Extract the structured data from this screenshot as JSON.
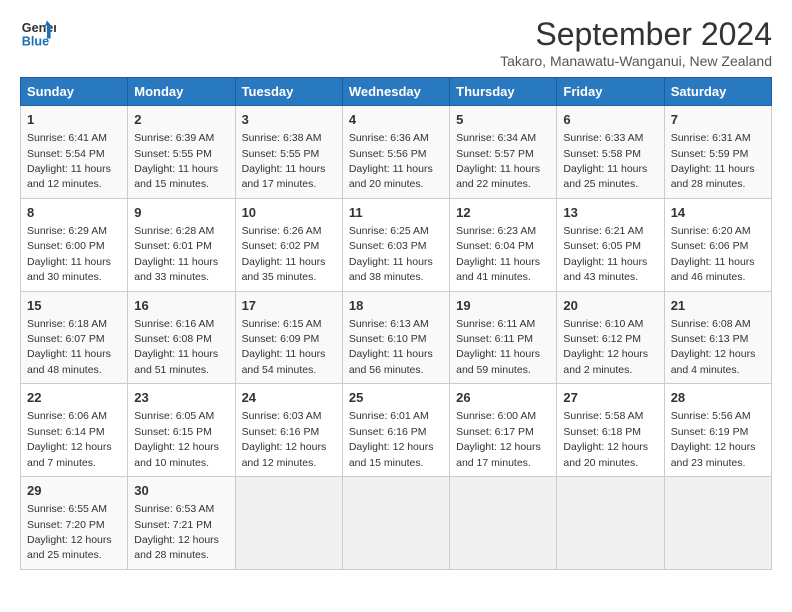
{
  "header": {
    "logo_line1": "General",
    "logo_line2": "Blue",
    "month": "September 2024",
    "location": "Takaro, Manawatu-Wanganui, New Zealand"
  },
  "weekdays": [
    "Sunday",
    "Monday",
    "Tuesday",
    "Wednesday",
    "Thursday",
    "Friday",
    "Saturday"
  ],
  "weeks": [
    [
      {
        "day": "1",
        "info": "Sunrise: 6:41 AM\nSunset: 5:54 PM\nDaylight: 11 hours\nand 12 minutes."
      },
      {
        "day": "2",
        "info": "Sunrise: 6:39 AM\nSunset: 5:55 PM\nDaylight: 11 hours\nand 15 minutes."
      },
      {
        "day": "3",
        "info": "Sunrise: 6:38 AM\nSunset: 5:55 PM\nDaylight: 11 hours\nand 17 minutes."
      },
      {
        "day": "4",
        "info": "Sunrise: 6:36 AM\nSunset: 5:56 PM\nDaylight: 11 hours\nand 20 minutes."
      },
      {
        "day": "5",
        "info": "Sunrise: 6:34 AM\nSunset: 5:57 PM\nDaylight: 11 hours\nand 22 minutes."
      },
      {
        "day": "6",
        "info": "Sunrise: 6:33 AM\nSunset: 5:58 PM\nDaylight: 11 hours\nand 25 minutes."
      },
      {
        "day": "7",
        "info": "Sunrise: 6:31 AM\nSunset: 5:59 PM\nDaylight: 11 hours\nand 28 minutes."
      }
    ],
    [
      {
        "day": "8",
        "info": "Sunrise: 6:29 AM\nSunset: 6:00 PM\nDaylight: 11 hours\nand 30 minutes."
      },
      {
        "day": "9",
        "info": "Sunrise: 6:28 AM\nSunset: 6:01 PM\nDaylight: 11 hours\nand 33 minutes."
      },
      {
        "day": "10",
        "info": "Sunrise: 6:26 AM\nSunset: 6:02 PM\nDaylight: 11 hours\nand 35 minutes."
      },
      {
        "day": "11",
        "info": "Sunrise: 6:25 AM\nSunset: 6:03 PM\nDaylight: 11 hours\nand 38 minutes."
      },
      {
        "day": "12",
        "info": "Sunrise: 6:23 AM\nSunset: 6:04 PM\nDaylight: 11 hours\nand 41 minutes."
      },
      {
        "day": "13",
        "info": "Sunrise: 6:21 AM\nSunset: 6:05 PM\nDaylight: 11 hours\nand 43 minutes."
      },
      {
        "day": "14",
        "info": "Sunrise: 6:20 AM\nSunset: 6:06 PM\nDaylight: 11 hours\nand 46 minutes."
      }
    ],
    [
      {
        "day": "15",
        "info": "Sunrise: 6:18 AM\nSunset: 6:07 PM\nDaylight: 11 hours\nand 48 minutes."
      },
      {
        "day": "16",
        "info": "Sunrise: 6:16 AM\nSunset: 6:08 PM\nDaylight: 11 hours\nand 51 minutes."
      },
      {
        "day": "17",
        "info": "Sunrise: 6:15 AM\nSunset: 6:09 PM\nDaylight: 11 hours\nand 54 minutes."
      },
      {
        "day": "18",
        "info": "Sunrise: 6:13 AM\nSunset: 6:10 PM\nDaylight: 11 hours\nand 56 minutes."
      },
      {
        "day": "19",
        "info": "Sunrise: 6:11 AM\nSunset: 6:11 PM\nDaylight: 11 hours\nand 59 minutes."
      },
      {
        "day": "20",
        "info": "Sunrise: 6:10 AM\nSunset: 6:12 PM\nDaylight: 12 hours\nand 2 minutes."
      },
      {
        "day": "21",
        "info": "Sunrise: 6:08 AM\nSunset: 6:13 PM\nDaylight: 12 hours\nand 4 minutes."
      }
    ],
    [
      {
        "day": "22",
        "info": "Sunrise: 6:06 AM\nSunset: 6:14 PM\nDaylight: 12 hours\nand 7 minutes."
      },
      {
        "day": "23",
        "info": "Sunrise: 6:05 AM\nSunset: 6:15 PM\nDaylight: 12 hours\nand 10 minutes."
      },
      {
        "day": "24",
        "info": "Sunrise: 6:03 AM\nSunset: 6:16 PM\nDaylight: 12 hours\nand 12 minutes."
      },
      {
        "day": "25",
        "info": "Sunrise: 6:01 AM\nSunset: 6:16 PM\nDaylight: 12 hours\nand 15 minutes."
      },
      {
        "day": "26",
        "info": "Sunrise: 6:00 AM\nSunset: 6:17 PM\nDaylight: 12 hours\nand 17 minutes."
      },
      {
        "day": "27",
        "info": "Sunrise: 5:58 AM\nSunset: 6:18 PM\nDaylight: 12 hours\nand 20 minutes."
      },
      {
        "day": "28",
        "info": "Sunrise: 5:56 AM\nSunset: 6:19 PM\nDaylight: 12 hours\nand 23 minutes."
      }
    ],
    [
      {
        "day": "29",
        "info": "Sunrise: 6:55 AM\nSunset: 7:20 PM\nDaylight: 12 hours\nand 25 minutes."
      },
      {
        "day": "30",
        "info": "Sunrise: 6:53 AM\nSunset: 7:21 PM\nDaylight: 12 hours\nand 28 minutes."
      },
      {
        "day": "",
        "info": ""
      },
      {
        "day": "",
        "info": ""
      },
      {
        "day": "",
        "info": ""
      },
      {
        "day": "",
        "info": ""
      },
      {
        "day": "",
        "info": ""
      }
    ]
  ]
}
